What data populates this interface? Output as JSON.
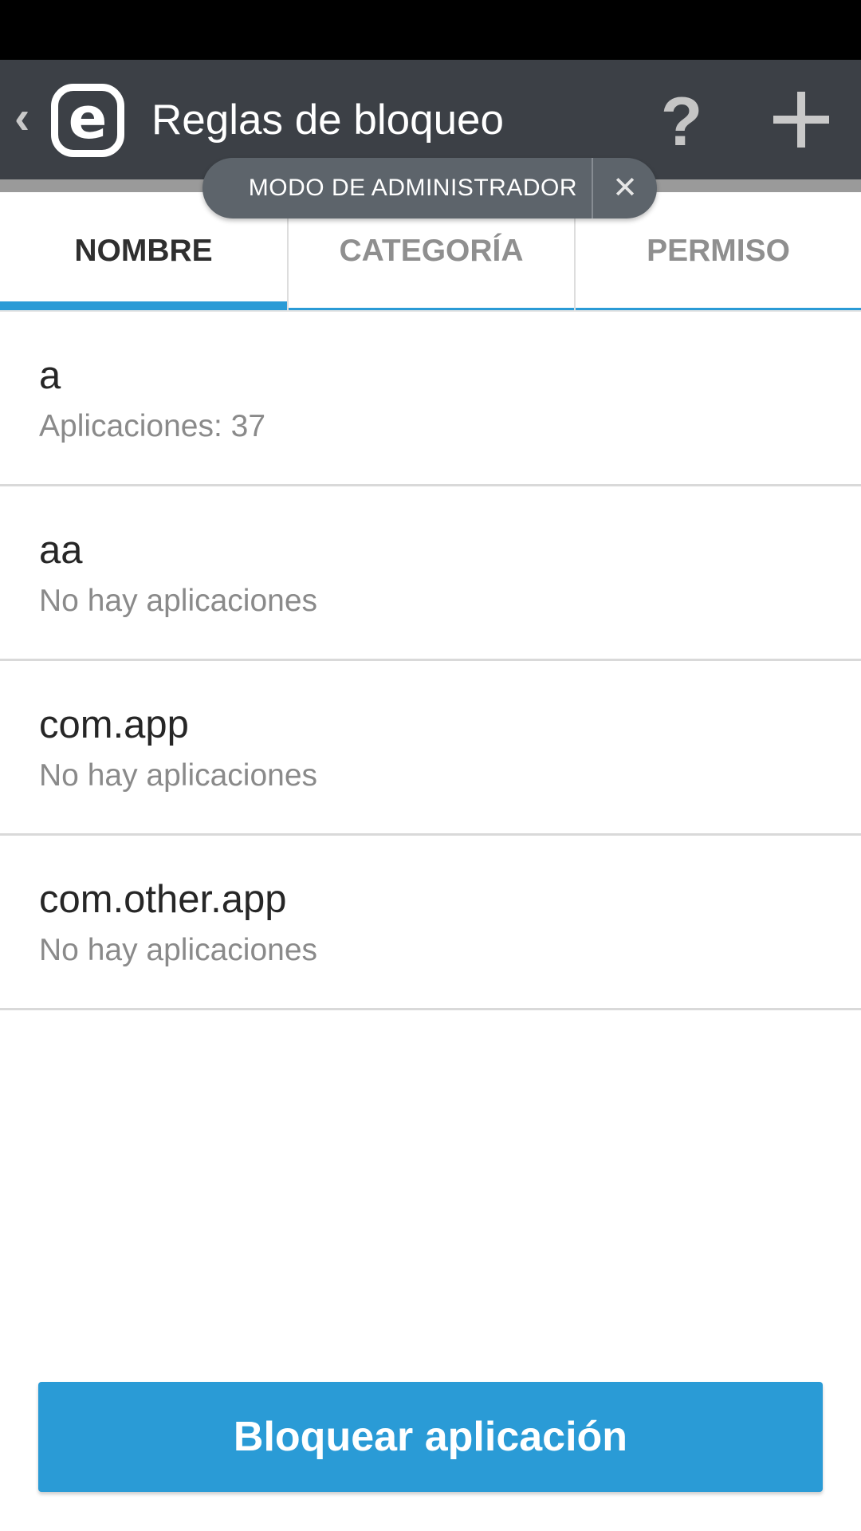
{
  "app_bar": {
    "title": "Reglas de bloqueo",
    "logo_letter": "e",
    "background": "#3c4046",
    "icons": [
      "back-chevron-icon",
      "eset-logo",
      "help-icon",
      "add-icon"
    ]
  },
  "admin_banner": {
    "label": "MODO DE ADMINISTRADOR",
    "close_glyph": "✕"
  },
  "tabs": [
    {
      "label": "NOMBRE",
      "active": true
    },
    {
      "label": "CATEGORÍA",
      "active": false
    },
    {
      "label": "PERMISO",
      "active": false
    }
  ],
  "rules": [
    {
      "name": "a",
      "subtitle": "Aplicaciones: 37"
    },
    {
      "name": "aa",
      "subtitle": "No hay aplicaciones"
    },
    {
      "name": "com.app",
      "subtitle": "No hay aplicaciones"
    },
    {
      "name": "com.other.app",
      "subtitle": "No hay aplicaciones"
    }
  ],
  "block_button": {
    "label": "Bloquear aplicación"
  },
  "colors": {
    "accent": "#2a9bd6",
    "status_bar": "#000000",
    "admin_pill": "#5d646b"
  }
}
